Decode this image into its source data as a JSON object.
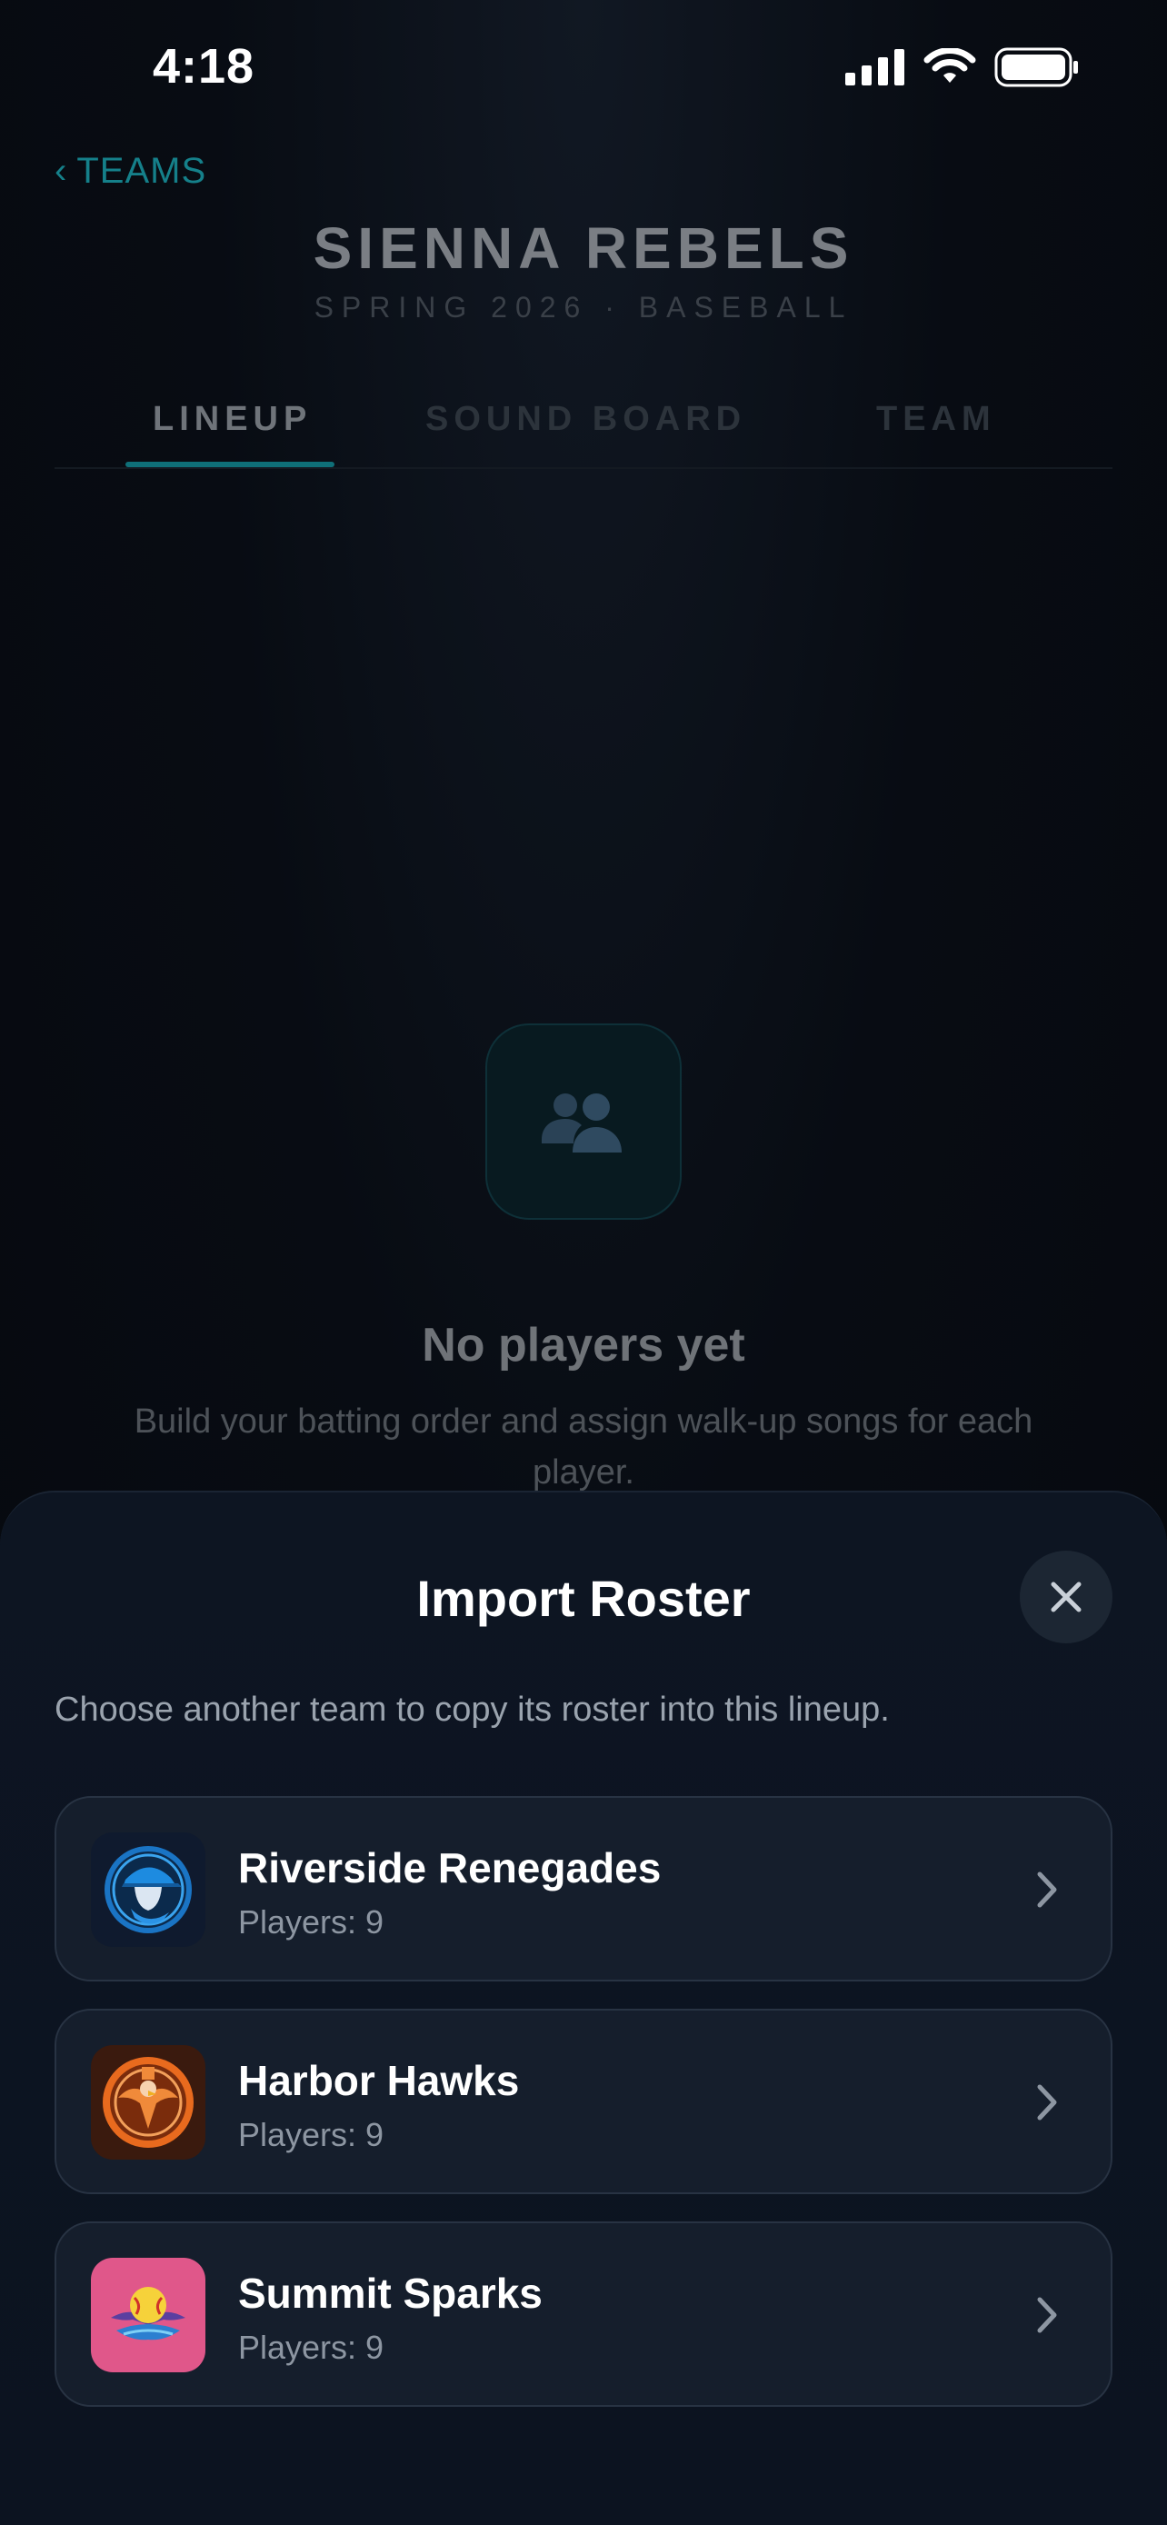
{
  "status_bar": {
    "time": "4:18"
  },
  "header": {
    "back_label": "TEAMS",
    "team_name": "SIENNA REBELS",
    "subtitle": "SPRING 2026 · BASEBALL"
  },
  "tabs": [
    {
      "label": "LINEUP",
      "active": true
    },
    {
      "label": "SOUND BOARD",
      "active": false
    },
    {
      "label": "TEAM",
      "active": false
    }
  ],
  "empty_state": {
    "icon": "people-icon",
    "title": "No players yet",
    "description": "Build your batting order and assign walk-up songs for each player."
  },
  "sheet": {
    "title": "Import Roster",
    "description": "Choose another team to copy its roster into this lineup.",
    "teams": [
      {
        "name": "Riverside Renegades",
        "players": "Players: 9",
        "logo": "renegades-logo"
      },
      {
        "name": "Harbor Hawks",
        "players": "Players: 9",
        "logo": "hawks-logo"
      },
      {
        "name": "Summit Sparks",
        "players": "Players: 9",
        "logo": "sparks-logo"
      }
    ]
  },
  "colors": {
    "accent": "#0f6f78",
    "sheet_bg": "#0d1522",
    "card_bg": "#151e2c"
  }
}
